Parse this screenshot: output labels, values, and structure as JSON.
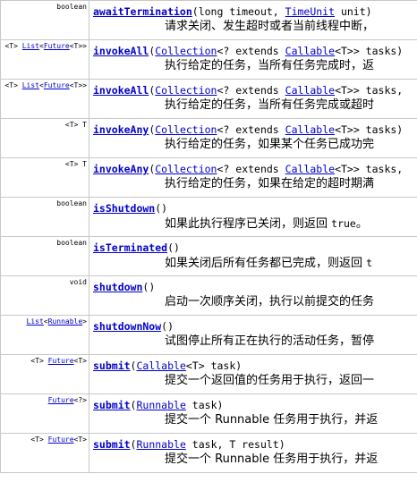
{
  "rows": [
    {
      "mod": [
        "boolean"
      ],
      "name": "awaitTermination",
      "params": [
        [
          "t",
          "(long timeout, "
        ],
        [
          "l",
          "TimeUnit"
        ],
        [
          "t",
          " unit)"
        ]
      ],
      "desc": [
        [
          "t",
          "请求关闭、发生超时或者当前线程中断，"
        ]
      ]
    },
    {
      "mod": [
        [
          "t",
          "<T> "
        ],
        [
          "l",
          "List"
        ],
        [
          "t",
          "<"
        ],
        [
          "l",
          "Future"
        ],
        [
          "t",
          "<T>>"
        ]
      ],
      "name": "invokeAll",
      "params": [
        [
          "t",
          "("
        ],
        [
          "l",
          "Collection"
        ],
        [
          "t",
          "<? extends "
        ],
        [
          "l",
          "Callable"
        ],
        [
          "t",
          "<T>> tasks)"
        ]
      ],
      "desc": [
        [
          "t",
          "执行给定的任务，当所有任务完成时，返"
        ]
      ]
    },
    {
      "mod": [
        [
          "t",
          "<T> "
        ],
        [
          "l",
          "List"
        ],
        [
          "t",
          "<"
        ],
        [
          "l",
          "Future"
        ],
        [
          "t",
          "<T>>"
        ]
      ],
      "name": "invokeAll",
      "params": [
        [
          "t",
          "("
        ],
        [
          "l",
          "Collection"
        ],
        [
          "t",
          "<? extends "
        ],
        [
          "l",
          "Callable"
        ],
        [
          "t",
          "<T>> tasks,"
        ]
      ],
      "desc": [
        [
          "t",
          "执行给定的任务，当所有任务完成或超时"
        ]
      ]
    },
    {
      "mod": [
        [
          "t",
          "<T> T"
        ]
      ],
      "name": "invokeAny",
      "params": [
        [
          "t",
          "("
        ],
        [
          "l",
          "Collection"
        ],
        [
          "t",
          "<? extends "
        ],
        [
          "l",
          "Callable"
        ],
        [
          "t",
          "<T>> tasks)"
        ]
      ],
      "desc": [
        [
          "t",
          "执行给定的任务，如果某个任务已成功完"
        ]
      ]
    },
    {
      "mod": [
        [
          "t",
          "<T> T"
        ]
      ],
      "name": "invokeAny",
      "params": [
        [
          "t",
          "("
        ],
        [
          "l",
          "Collection"
        ],
        [
          "t",
          "<? extends "
        ],
        [
          "l",
          "Callable"
        ],
        [
          "t",
          "<T>> tasks,"
        ]
      ],
      "desc": [
        [
          "t",
          "执行给定的任务，如果在给定的超时期满"
        ]
      ]
    },
    {
      "mod": [
        [
          "t",
          "boolean"
        ]
      ],
      "name": "isShutdown",
      "params": [
        [
          "t",
          "()"
        ]
      ],
      "desc": [
        [
          "t",
          "如果此执行程序已关闭，则返回 "
        ],
        [
          "c",
          "true"
        ],
        [
          "t",
          "。"
        ]
      ]
    },
    {
      "mod": [
        [
          "t",
          "boolean"
        ]
      ],
      "name": "isTerminated",
      "params": [
        [
          "t",
          "()"
        ]
      ],
      "desc": [
        [
          "t",
          "如果关闭后所有任务都已完成，则返回 "
        ],
        [
          "c",
          "t"
        ]
      ]
    },
    {
      "mod": [
        [
          "t",
          "void"
        ]
      ],
      "name": "shutdown",
      "params": [
        [
          "t",
          "()"
        ]
      ],
      "desc": [
        [
          "t",
          "启动一次顺序关闭，执行以前提交的任务"
        ]
      ]
    },
    {
      "mod": [
        [
          "l",
          "List"
        ],
        [
          "t",
          "<"
        ],
        [
          "l",
          "Runnable"
        ],
        [
          "t",
          ">"
        ]
      ],
      "name": "shutdownNow",
      "params": [
        [
          "t",
          "()"
        ]
      ],
      "desc": [
        [
          "t",
          "试图停止所有正在执行的活动任务，暂停"
        ]
      ]
    },
    {
      "mod": [
        [
          "t",
          "<T> "
        ],
        [
          "l",
          "Future"
        ],
        [
          "t",
          "<T>"
        ]
      ],
      "name": "submit",
      "params": [
        [
          "t",
          "("
        ],
        [
          "l",
          "Callable"
        ],
        [
          "t",
          "<T> task)"
        ]
      ],
      "desc": [
        [
          "t",
          "提交一个返回值的任务用于执行，返回一"
        ]
      ]
    },
    {
      "mod": [
        [
          "l",
          "Future"
        ],
        [
          "t",
          "<?>"
        ]
      ],
      "name": "submit",
      "params": [
        [
          "t",
          "("
        ],
        [
          "l",
          "Runnable"
        ],
        [
          "t",
          " task)"
        ]
      ],
      "desc": [
        [
          "t",
          "提交一个 Runnable 任务用于执行，并返"
        ]
      ]
    },
    {
      "mod": [
        [
          "t",
          "<T> "
        ],
        [
          "l",
          "Future"
        ],
        [
          "t",
          "<T>"
        ]
      ],
      "name": "submit",
      "params": [
        [
          "t",
          "("
        ],
        [
          "l",
          "Runnable"
        ],
        [
          "t",
          " task, T result)"
        ]
      ],
      "desc": [
        [
          "t",
          "提交一个 Runnable 任务用于执行，并返"
        ]
      ]
    }
  ]
}
